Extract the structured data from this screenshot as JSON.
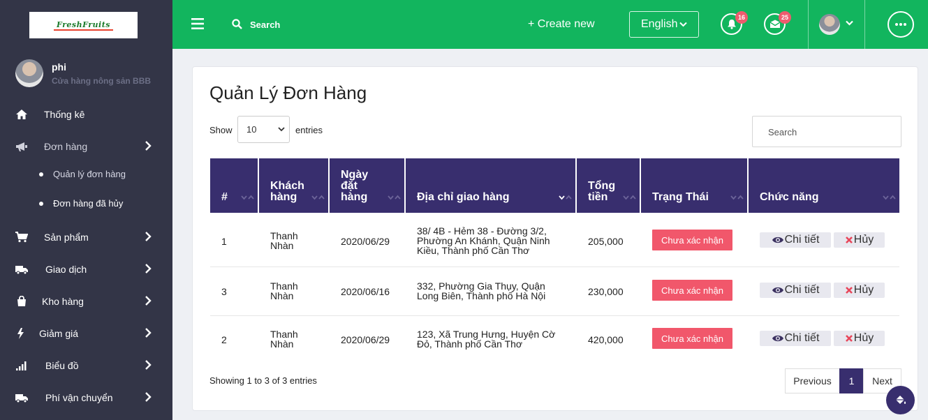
{
  "brand": {
    "logo_text": "FreshFruits"
  },
  "user": {
    "name": "phi",
    "store": "Cửa hàng nông sản BBB"
  },
  "sidebar": {
    "items": [
      {
        "label": "Thống kê",
        "icon": "home-icon"
      },
      {
        "label": "Đơn hàng",
        "icon": "megaphone-icon"
      },
      {
        "label": "Sản phẩm",
        "icon": "cart-icon"
      },
      {
        "label": "Giao dịch",
        "icon": "truck-icon"
      },
      {
        "label": "Kho hàng",
        "icon": "bag-icon"
      },
      {
        "label": "Giảm giá",
        "icon": "bolt-icon"
      },
      {
        "label": "Biểu đồ",
        "icon": "signal-icon"
      },
      {
        "label": "Phí vận chuyển",
        "icon": "truck-icon"
      }
    ],
    "subitems": [
      {
        "label": "Quản lý đơn hàng"
      },
      {
        "label": "Đơn hàng đã hủy"
      }
    ]
  },
  "topbar": {
    "search_label": "Search",
    "create_label": "+ Create new",
    "language": "English",
    "notifications_count": "16",
    "messages_count": "25"
  },
  "main": {
    "title": "Quản Lý Đơn Hàng",
    "show_label": "Show",
    "page_length": "10",
    "entries_label": "entries",
    "search_placeholder": "Search",
    "columns": [
      "#",
      "Khách hàng",
      "Ngày đặt hàng",
      "Địa chỉ giao hàng",
      "Tổng tiền",
      "Trạng Thái",
      "Chức năng"
    ],
    "rows": [
      {
        "id": "1",
        "customer": "Thanh Nhàn",
        "date": "2020/06/29",
        "address": "38/ 4B - Hẻm 38 - Đường 3/2, Phường An Khánh, Quận Ninh Kiều, Thành phố Cần Thơ",
        "total": "205,000",
        "status": "Chưa xác nhận"
      },
      {
        "id": "3",
        "customer": "Thanh Nhàn",
        "date": "2020/06/16",
        "address": "332, Phường Gia Thụy, Quận Long Biên, Thành phố Hà Nội",
        "total": "230,000",
        "status": "Chưa xác nhận"
      },
      {
        "id": "2",
        "customer": "Thanh Nhàn",
        "date": "2020/06/29",
        "address": "123, Xã Trung Hưng, Huyện Cờ Đỏ, Thành phố Cần Thơ",
        "total": "420,000",
        "status": "Chưa xác nhận"
      }
    ],
    "detail_label": "Chi tiết",
    "cancel_label": "Hủy",
    "showing_text": "Showing 1 to 3 of 3 entries",
    "pagination": {
      "previous": "Previous",
      "current": "1",
      "next": "Next"
    }
  },
  "colors": {
    "sidebar": "#333547",
    "topbar": "#12b55e",
    "table_header": "#382e6e",
    "status": "#f1576b"
  }
}
